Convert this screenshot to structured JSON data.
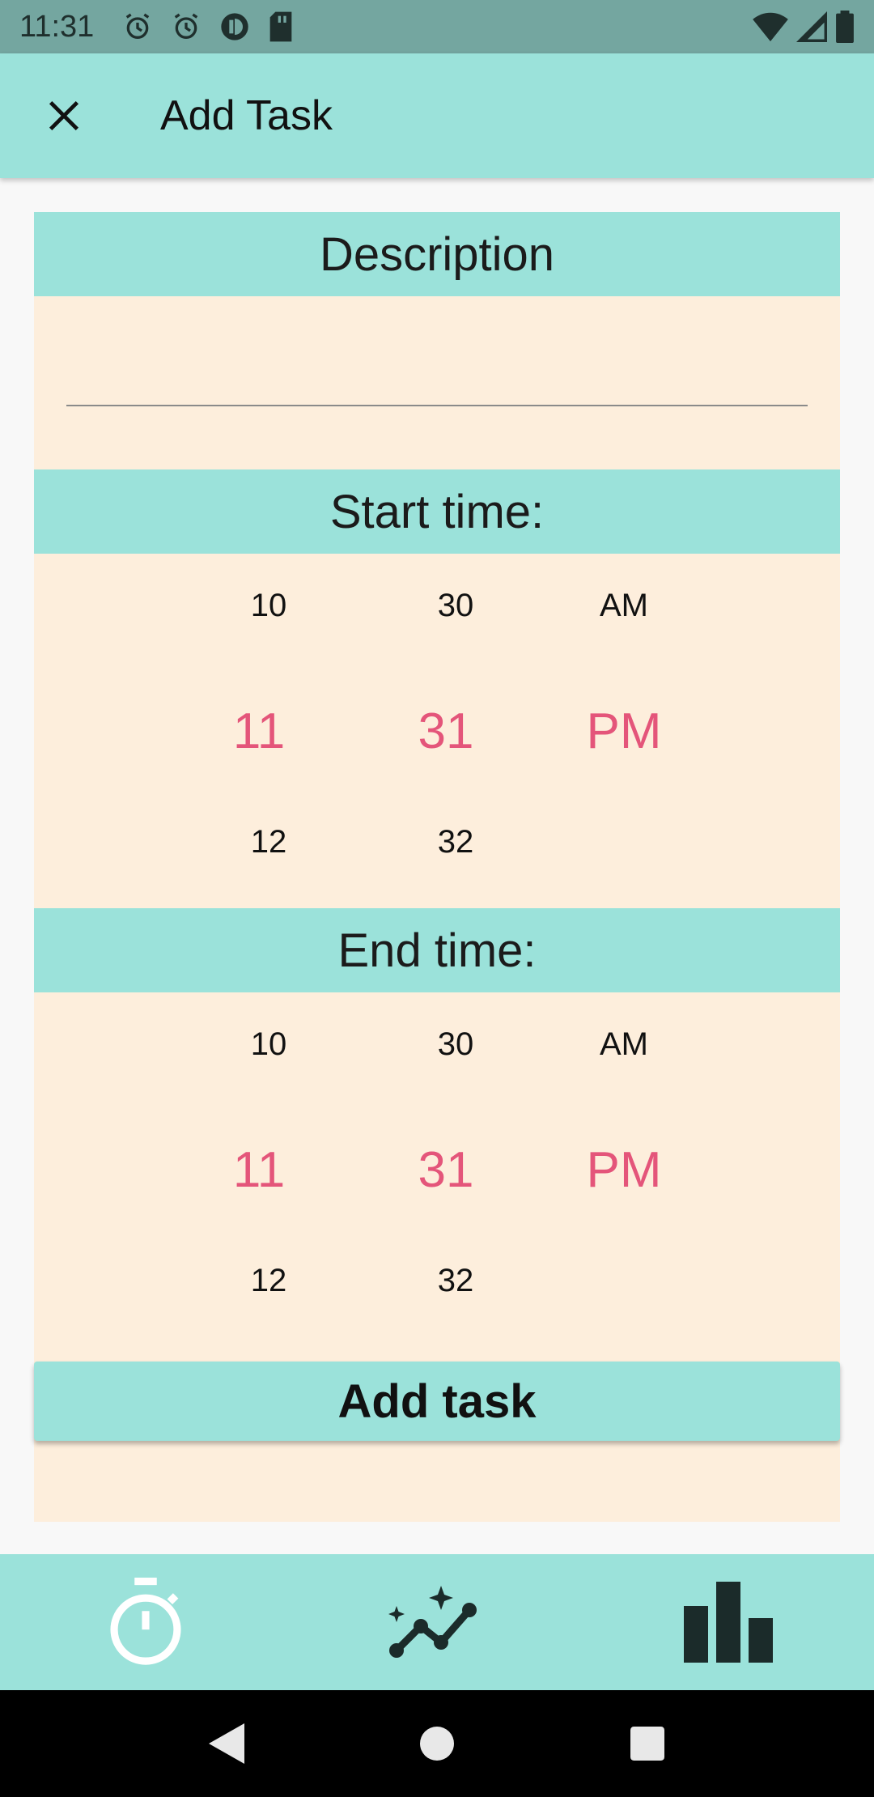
{
  "status_bar": {
    "time": "11:31",
    "left_icons": [
      "alarm-icon",
      "alarm-icon",
      "data-saver-icon",
      "sd-card-icon"
    ],
    "right_icons": [
      "wifi-icon",
      "cell-signal-icon",
      "battery-icon"
    ]
  },
  "app_bar": {
    "title": "Add Task",
    "close_icon": "close-icon"
  },
  "form": {
    "description_header": "Description",
    "description_value": "",
    "start_header": "Start time:",
    "end_header": "End time:",
    "submit_label": "Add task"
  },
  "start_picker": {
    "hours": {
      "prev": "10",
      "selected": "11",
      "next": "12"
    },
    "minutes": {
      "prev": "30",
      "selected": "31",
      "next": "32"
    },
    "ampm": {
      "prev": "AM",
      "selected": "PM",
      "next": ""
    }
  },
  "end_picker": {
    "hours": {
      "prev": "10",
      "selected": "11",
      "next": "12"
    },
    "minutes": {
      "prev": "30",
      "selected": "31",
      "next": "32"
    },
    "ampm": {
      "prev": "AM",
      "selected": "PM",
      "next": ""
    }
  },
  "bottom_nav": {
    "items": [
      "timer-icon",
      "insights-icon",
      "bar-chart-icon"
    ]
  },
  "colors": {
    "accent": "#9be2da",
    "form_bg": "#fdeedc",
    "selected_text": "#e4557a",
    "status_bar": "#74a6a0"
  }
}
